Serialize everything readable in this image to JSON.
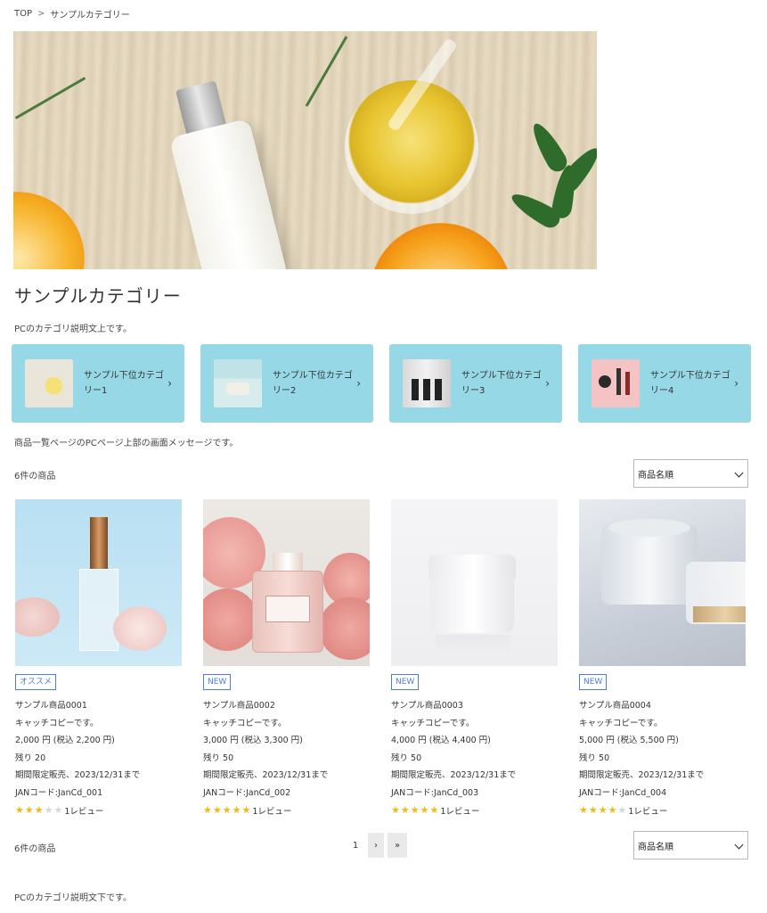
{
  "breadcrumb": {
    "home": "TOP",
    "separator": ">",
    "current": "サンプルカテゴリー"
  },
  "category": {
    "title": "サンプルカテゴリー",
    "description_top": "PCのカテゴリ説明文上です。",
    "description_bottom": "PCのカテゴリ説明文下です。"
  },
  "subcategories": [
    {
      "label": "サンプル下位カテゴリー1",
      "chevron": "›"
    },
    {
      "label": "サンプル下位カテゴリー2",
      "chevron": "›"
    },
    {
      "label": "サンプル下位カテゴリー3",
      "chevron": "›"
    },
    {
      "label": "サンプル下位カテゴリー4",
      "chevron": "›"
    }
  ],
  "list_message": "商品一覧ページのPCページ上部の画面メッセージです。",
  "product_count": "6件の商品",
  "sort": {
    "selected": "商品名順"
  },
  "products": [
    {
      "badge": "オススメ",
      "name": "サンプル商品0001",
      "catch": "キャッチコピーです。",
      "price": "2,000 円 (税込 2,200 円)",
      "stock": "残り 20",
      "limited": "期間限定販売、2023/12/31まで",
      "jan": "JANコード:JanCd_001",
      "rating": 3,
      "reviews": "1レビュー"
    },
    {
      "badge": "NEW",
      "name": "サンプル商品0002",
      "catch": "キャッチコピーです。",
      "price": "3,000 円 (税込 3,300 円)",
      "stock": "残り 50",
      "limited": "期間限定販売、2023/12/31まで",
      "jan": "JANコード:JanCd_002",
      "rating": 5,
      "reviews": "1レビュー"
    },
    {
      "badge": "NEW",
      "name": "サンプル商品0003",
      "catch": "キャッチコピーです。",
      "price": "4,000 円 (税込 4,400 円)",
      "stock": "残り 50",
      "limited": "期間限定販売、2023/12/31まで",
      "jan": "JANコード:JanCd_003",
      "rating": 5,
      "reviews": "1レビュー"
    },
    {
      "badge": "NEW",
      "name": "サンプル商品0004",
      "catch": "キャッチコピーです。",
      "price": "5,000 円 (税込 5,500 円)",
      "stock": "残り 50",
      "limited": "期間限定販売、2023/12/31まで",
      "jan": "JANコード:JanCd_004",
      "rating": 4,
      "reviews": "1レビュー"
    }
  ],
  "pagination": {
    "current": "1",
    "next": "›",
    "last": "»"
  },
  "colors": {
    "subcategory_bg": "#96d8e6",
    "badge": "#4d7fd1",
    "star_on": "#f2b90f",
    "star_off": "#d6d6d6"
  },
  "icons": {
    "chevron": "chevron-right-icon",
    "star": "star-icon",
    "caret": "chevron-down-icon"
  }
}
